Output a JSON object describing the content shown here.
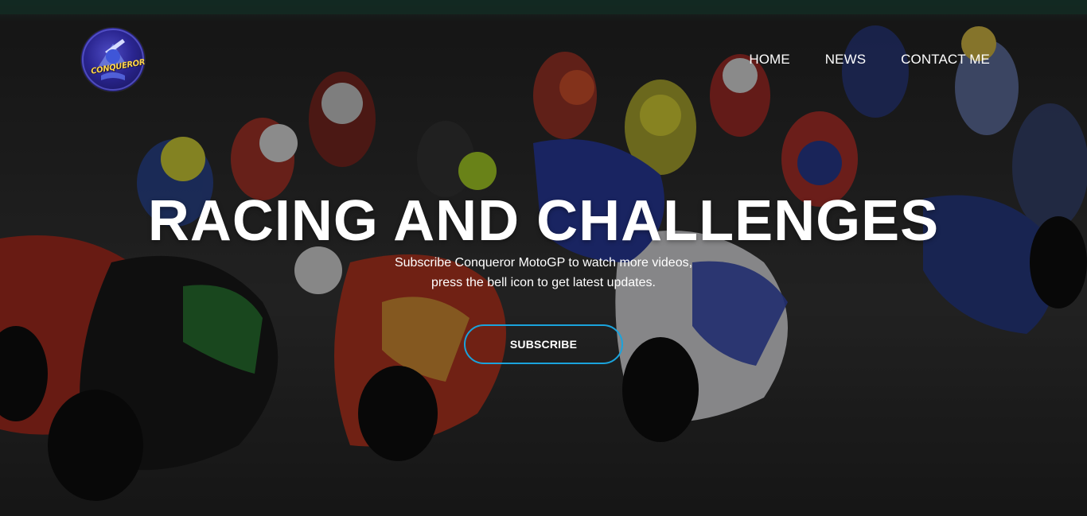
{
  "header": {
    "logo_alt": "Conqueror",
    "logo_text": "CONQUEROR",
    "nav": [
      {
        "label": "HOME"
      },
      {
        "label": "NEWS"
      },
      {
        "label": "CONTACT ME"
      }
    ]
  },
  "hero": {
    "title": "RACING AND CHALLENGES",
    "subtitle_line1": "Subscribe Conqueror MotoGP to watch more videos,",
    "subtitle_line2": "press the bell icon to get latest updates.",
    "button_label": "SUBSCRIBE"
  },
  "colors": {
    "accent": "#1aa3dc",
    "text": "#ffffff",
    "logo_bg": "#2a2590"
  }
}
